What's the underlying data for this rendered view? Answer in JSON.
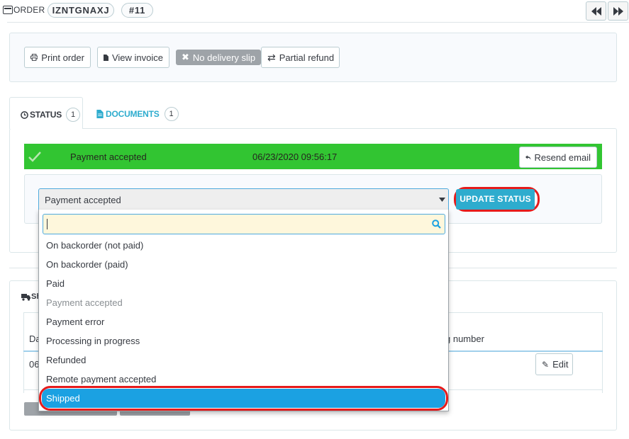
{
  "header": {
    "title": "ORDER",
    "reference": "IZNTGNAXJ",
    "order_number": "#11"
  },
  "toolbar": {
    "print_order": "Print order",
    "view_invoice": "View invoice",
    "no_delivery_slip": "No delivery slip",
    "partial_refund": "Partial refund"
  },
  "tabs": [
    {
      "label": "STATUS",
      "count": "1"
    },
    {
      "label": "DOCUMENTS",
      "count": "1"
    }
  ],
  "status": {
    "current": "Payment accepted",
    "date": "06/23/2020 09:56:17",
    "resend_email": "Resend email",
    "color": "#32c532"
  },
  "status_form": {
    "selected": "Payment accepted",
    "update_button": "UPDATE STATUS",
    "search_value": "",
    "options": [
      {
        "label": "On backorder (not paid)",
        "state": "normal"
      },
      {
        "label": "On backorder (paid)",
        "state": "normal"
      },
      {
        "label": "Paid",
        "state": "normal"
      },
      {
        "label": "Payment accepted",
        "state": "disabled"
      },
      {
        "label": "Payment error",
        "state": "normal"
      },
      {
        "label": "Processing in progress",
        "state": "normal"
      },
      {
        "label": "Refunded",
        "state": "normal"
      },
      {
        "label": "Remote payment accepted",
        "state": "normal"
      },
      {
        "label": "Shipped",
        "state": "highlighted"
      }
    ]
  },
  "shipping": {
    "title_partial": "Sh",
    "col_date_partial": "Da",
    "row_date_partial": "06",
    "col_tracking_partial": "g number",
    "edit_button": "Edit"
  },
  "colors": {
    "accent": "#2eacce",
    "highlight": "#1ba1e2",
    "annotation": "#e51b1b"
  }
}
